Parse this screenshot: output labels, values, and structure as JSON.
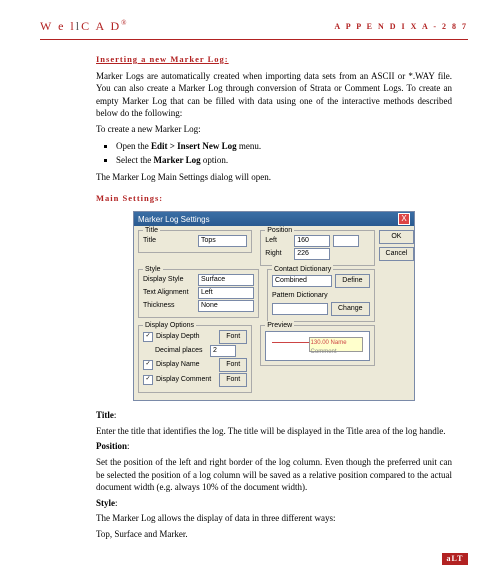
{
  "header": {
    "logo_pre": "W e l",
    "logo_bar": "l",
    "logo_post": "C A D",
    "logo_reg": "®",
    "appendix": "A P P E N D I X   A   -   2 8 7"
  },
  "sec": {
    "inserting": "Inserting a new Marker Log:",
    "main_settings": "Main Settings:"
  },
  "p1": "Marker Logs are automatically created when importing data sets from an ASCII or *.WAY file. You can also create a Marker Log through conversion of Strata or Comment Logs. To create an empty Marker Log that can be filled with data using one of the interactive methods described below do the following:",
  "p2": "To create a new Marker Log:",
  "li1_pre": "Open the ",
  "li1_bold": "Edit > Insert New Log",
  "li1_post": " menu.",
  "li2_pre": "Select the ",
  "li2_bold": "Marker Log",
  "li2_post": " option.",
  "p3": "The Marker Log Main Settings dialog will open.",
  "dlg": {
    "title": "Marker Log Settings",
    "close": "X",
    "ok": "OK",
    "cancel": "Cancel",
    "title_grp": "Title",
    "title_lbl": "Title",
    "title_val": "Tops",
    "pos_grp": "Position",
    "left_lbl": "Left",
    "left_val": "160",
    "right_lbl": "Right",
    "right_val": "226",
    "style_grp": "Style",
    "disp_style": "Display Style",
    "disp_val": "Surface",
    "text_align": "Text Alignment",
    "text_val": "Left",
    "thick": "Thickness",
    "thick_val": "None",
    "contact_grp": "Contact Dictionary",
    "combined": "Combined",
    "define": "Define",
    "pattern": "Pattern Dictionary",
    "change": "Change",
    "dispopt_grp": "Display Options",
    "disp_depth": "Display Depth",
    "dec_places": "Decimal places",
    "dec_val": "2",
    "disp_name": "Display Name",
    "disp_comment": "Display Comment",
    "font": "Font",
    "preview_grp": "Preview",
    "preview_text": "130.00  Name",
    "comment": "Comment"
  },
  "title_label": "Title",
  "title_colon": ":",
  "p_title": "Enter the title that identifies the log. The title will be displayed in the Title area of the log handle.",
  "pos_label": "Position",
  "pos_colon": ":",
  "p_pos": "Set the position of the left and right border of the log column. Even though the preferred unit can be selected the position of a log column will be saved as a relative position compared to the actual document width (e.g. always 10% of the document width).",
  "style_label": "Style",
  "style_colon": ":",
  "p_style1": "The Marker Log allows the display of data in three different ways:",
  "p_style2": "Top, Surface and Marker.",
  "footer": "aLT"
}
